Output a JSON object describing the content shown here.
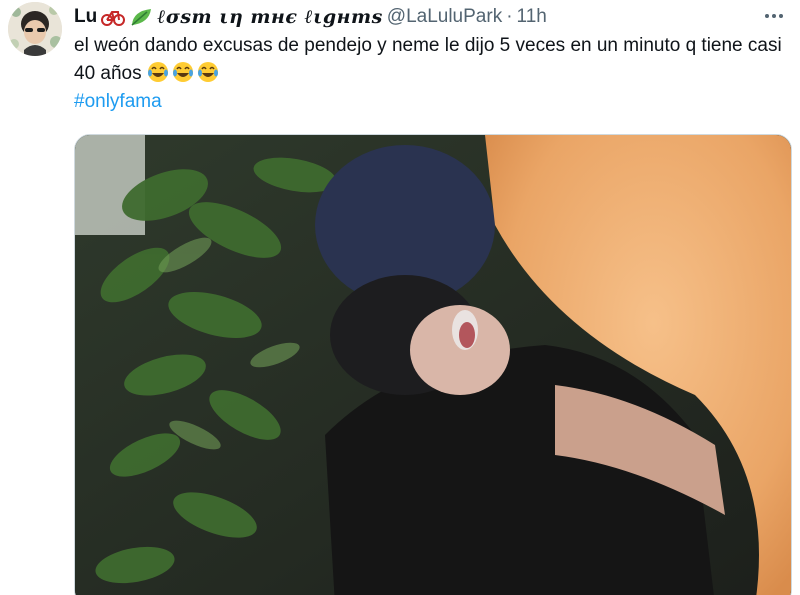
{
  "author": {
    "display_name": "Lu",
    "fancy_name": "ℓσѕт ιη тнє ℓιgнтѕ",
    "handle": "@LaLuluPark",
    "separator": "·",
    "time": "11h",
    "avatar_icon": "profile-avatar",
    "name_emojis": [
      "bicycle-icon",
      "leaf-icon"
    ]
  },
  "tweet": {
    "text": "el weón dando excusas de pendejo y neme le dijo 5 veces en un minuto q tiene casi 40 años",
    "emojis": [
      "laughing-crying-icon",
      "laughing-crying-icon",
      "laughing-crying-icon"
    ],
    "hashtag": "#onlyfama"
  },
  "media": {
    "type": "video-frame",
    "description_icon": "video-thumbnail"
  },
  "colors": {
    "text": "#0f1419",
    "secondary": "#536471",
    "link": "#1d9bf0",
    "border": "#cfd9de"
  },
  "menu_icon": "more-options-icon"
}
